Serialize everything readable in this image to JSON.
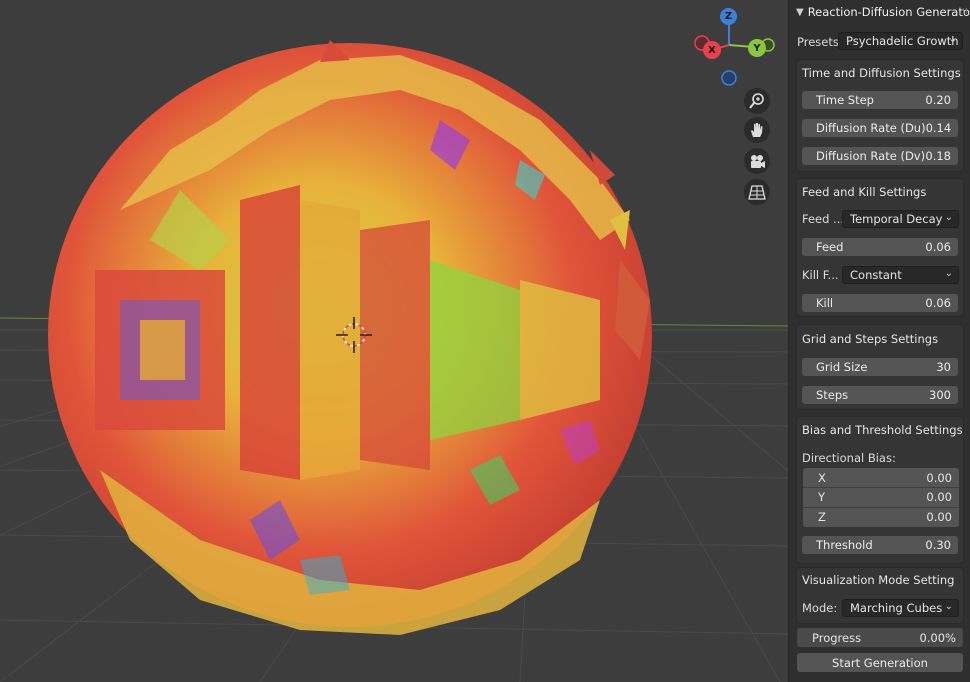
{
  "panel": {
    "title": "Reaction-Diffusion Generator",
    "presets_label": "Presets:",
    "presets_value": "Psychadelic Growth",
    "time_section": {
      "title": "Time and Diffusion Settings",
      "fields": [
        {
          "label": "Time Step",
          "value": "0.20"
        },
        {
          "label": "Diffusion Rate (Du)",
          "value": "0.14"
        },
        {
          "label": "Diffusion Rate (Dv)",
          "value": "0.18"
        }
      ]
    },
    "feed_section": {
      "title": "Feed and Kill Settings",
      "feed_mode_label": "Feed ...",
      "feed_mode_value": "Temporal Decay",
      "feed_label": "Feed",
      "feed_value": "0.06",
      "kill_mode_label": "Kill F...",
      "kill_mode_value": "Constant",
      "kill_label": "Kill",
      "kill_value": "0.06"
    },
    "grid_section": {
      "title": "Grid and Steps Settings",
      "fields": [
        {
          "label": "Grid Size",
          "value": "30"
        },
        {
          "label": "Steps",
          "value": "300"
        }
      ]
    },
    "bias_section": {
      "title": "Bias and Threshold Settings",
      "directional_label": "Directional Bias:",
      "bias": [
        {
          "label": "X",
          "value": "0.00"
        },
        {
          "label": "Y",
          "value": "0.00"
        },
        {
          "label": "Z",
          "value": "0.00"
        }
      ],
      "threshold_label": "Threshold",
      "threshold_value": "0.30"
    },
    "vis_section": {
      "title": "Visualization Mode Setting",
      "mode_label": "Mode:",
      "mode_value": "Marching Cubes"
    },
    "progress_label": "Progress",
    "progress_value": "0.00%",
    "start_label": "Start Generation"
  },
  "gizmo": {
    "x_label": "X",
    "y_label": "Y",
    "z_label": "Z"
  },
  "colors": {
    "x_axis": "#e8404f",
    "y_axis": "#8bc63e",
    "z_axis": "#3f7fd8",
    "panel_bg": "#2f2f2f"
  }
}
